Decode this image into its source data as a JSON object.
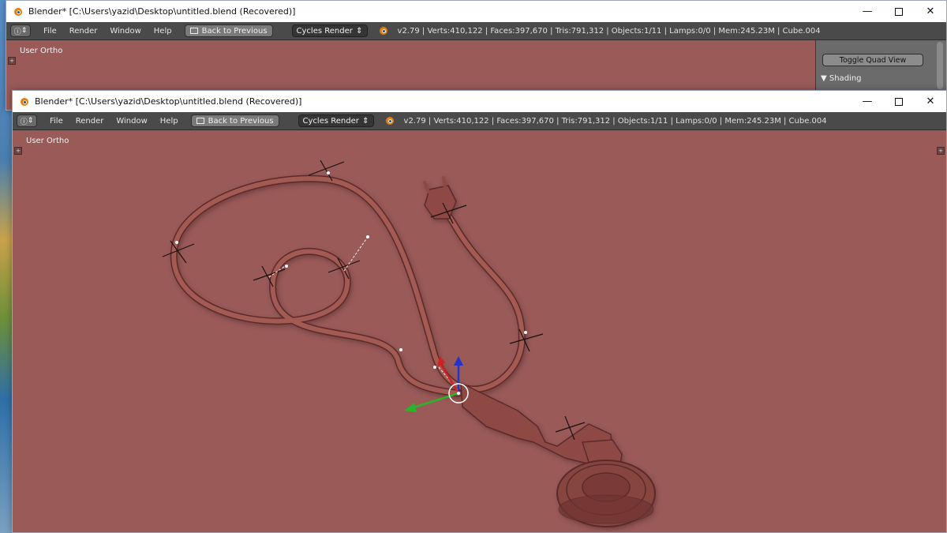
{
  "windows": [
    {
      "title": "Blender* [C:\\Users\\yazid\\Desktop\\untitled.blend (Recovered)]",
      "menu": [
        "File",
        "Render",
        "Window",
        "Help"
      ],
      "back_button": "Back to Previous",
      "render_engine": "Cycles Render",
      "stats": "v2.79 | Verts:410,122 | Faces:397,670 | Tris:791,312 | Objects:1/11 | Lamps:0/0 | Mem:245.23M | Cube.004",
      "view_label": "User Ortho",
      "side_panel": {
        "toggle_button": "Toggle Quad View",
        "section": "Shading"
      }
    },
    {
      "title": "Blender* [C:\\Users\\yazid\\Desktop\\untitled.blend (Recovered)]",
      "menu": [
        "File",
        "Render",
        "Window",
        "Help"
      ],
      "back_button": "Back to Previous",
      "render_engine": "Cycles Render",
      "stats": "v2.79 | Verts:410,122 | Faces:397,670 | Tris:791,312 | Objects:1/11 | Lamps:0/0 | Mem:245.23M | Cube.004",
      "view_label": "User Ortho"
    }
  ],
  "icons": {
    "window_controls": [
      "minimize-icon",
      "maximize-icon",
      "close-icon"
    ],
    "editor_type": "info-icon",
    "window_glyphs": {
      "minimize": "—",
      "close": "✕",
      "editor": "ⓘ",
      "updown": "⇕"
    }
  },
  "colors": {
    "viewport_bg": "#995a58",
    "header_bg": "#4a4a4a",
    "model": "#8e4a44",
    "gizmo_x": "#d22020",
    "gizmo_y": "#29b52a",
    "gizmo_z": "#2433c8"
  }
}
